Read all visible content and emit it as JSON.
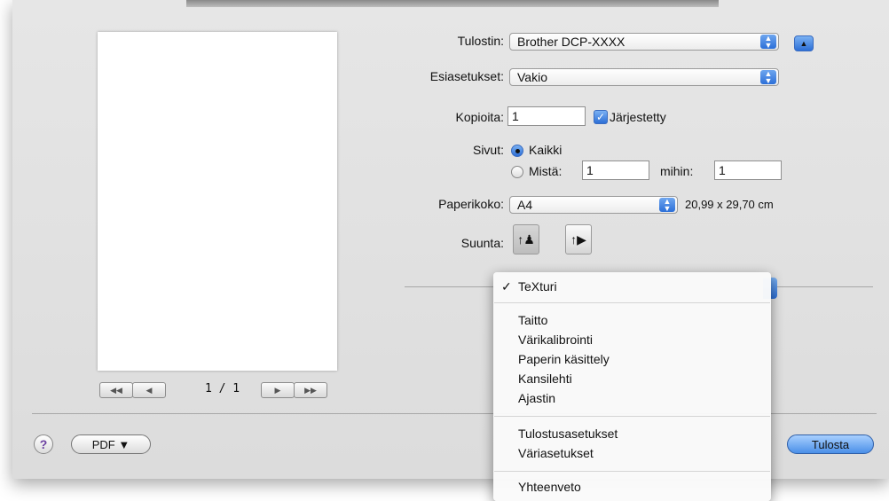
{
  "printer": {
    "label": "Tulostin:",
    "value": "Brother DCP-XXXX"
  },
  "presets": {
    "label": "Esiasetukset:",
    "value": "Vakio"
  },
  "copies": {
    "label": "Kopioita:",
    "value": "1",
    "collated_label": "Järjestetty",
    "collated_checked": true
  },
  "pages": {
    "label": "Sivut:",
    "all_label": "Kaikki",
    "from_label": "Mistä:",
    "from_value": "1",
    "to_label": "mihin:",
    "to_value": "1"
  },
  "paper_size": {
    "label": "Paperikoko:",
    "value": "A4",
    "dimensions": "20,99 x 29,70 cm"
  },
  "orientation": {
    "label": "Suunta:"
  },
  "preview": {
    "page_count": "1 / 1"
  },
  "footer": {
    "help": "?",
    "pdf_button": "PDF ▼",
    "print_button": "Tulosta"
  },
  "menu": {
    "selected": "TeXturi",
    "check": "✓",
    "group1": [
      "Taitto",
      "Värikalibrointi",
      "Paperin käsittely",
      "Kansilehti",
      "Ajastin"
    ],
    "group2": [
      "Tulostusasetukset",
      "Väriasetukset"
    ],
    "group3": [
      "Yhteenveto"
    ]
  }
}
